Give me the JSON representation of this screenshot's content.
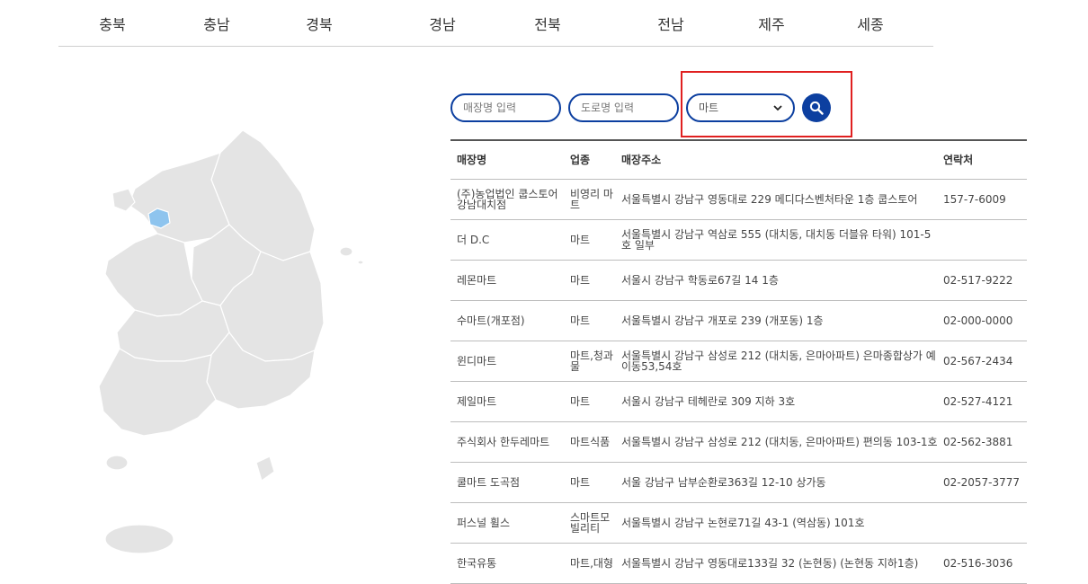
{
  "regions": [
    "충북",
    "충남",
    "경북",
    "경남",
    "전북",
    "전남",
    "제주",
    "세종"
  ],
  "search": {
    "store_placeholder": "매장명 입력",
    "road_placeholder": "도로명 입력",
    "category_selected": "마트"
  },
  "colors": {
    "accent": "#0c3fa0",
    "highlight": "#e02020",
    "map_fill": "#e4e4e4",
    "map_selected": "#8ec4ee"
  },
  "table": {
    "headers": {
      "name": "매장명",
      "type": "업종",
      "address": "매장주소",
      "phone": "연락처"
    },
    "rows": [
      {
        "name": "(주)농업법인 쿱스토어 강남대치점",
        "type": "비영리 마트",
        "address": "서울특별시 강남구 영동대로 229 메디다스벤처타운 1층 쿱스토어",
        "phone": "157-7-6009"
      },
      {
        "name": "더 D.C",
        "type": "마트",
        "address": "서울특별시 강남구 역삼로 555 (대치동, 대치동 더블유 타워) 101-5호 일부",
        "phone": ""
      },
      {
        "name": "레몬마트",
        "type": "마트",
        "address": "서울시 강남구 학동로67길 14 1층",
        "phone": "02-517-9222"
      },
      {
        "name": "수마트(개포점)",
        "type": "마트",
        "address": "서울특별시 강남구 개포로 239 (개포동) 1층",
        "phone": "02-000-0000"
      },
      {
        "name": "윈디마트",
        "type": "마트,청과물",
        "address": "서울특별시 강남구 삼성로 212 (대치동, 은마아파트) 은마종합상가 예이동53,54호",
        "phone": "02-567-2434"
      },
      {
        "name": "제일마트",
        "type": "마트",
        "address": "서울시 강남구 테헤란로 309 지하 3호",
        "phone": "02-527-4121"
      },
      {
        "name": "주식회사 한두레마트",
        "type": "마트식품",
        "address": "서울특별시 강남구 삼성로 212 (대치동, 은마아파트) 편의동 103-1호",
        "phone": "02-562-3881"
      },
      {
        "name": "쿨마트 도곡점",
        "type": "마트",
        "address": "서울 강남구 남부순환로363길 12-10 상가동",
        "phone": "02-2057-3777"
      },
      {
        "name": "퍼스널 휠스",
        "type": "스마트모빌리티",
        "address": "서울특별시 강남구 논현로71길 43-1 (역삼동) 101호",
        "phone": ""
      },
      {
        "name": "한국유통",
        "type": "마트,대형",
        "address": "서울특별시 강남구 영동대로133길 32 (논현동) (논현동 지하1층)",
        "phone": "02-516-3036"
      }
    ]
  }
}
